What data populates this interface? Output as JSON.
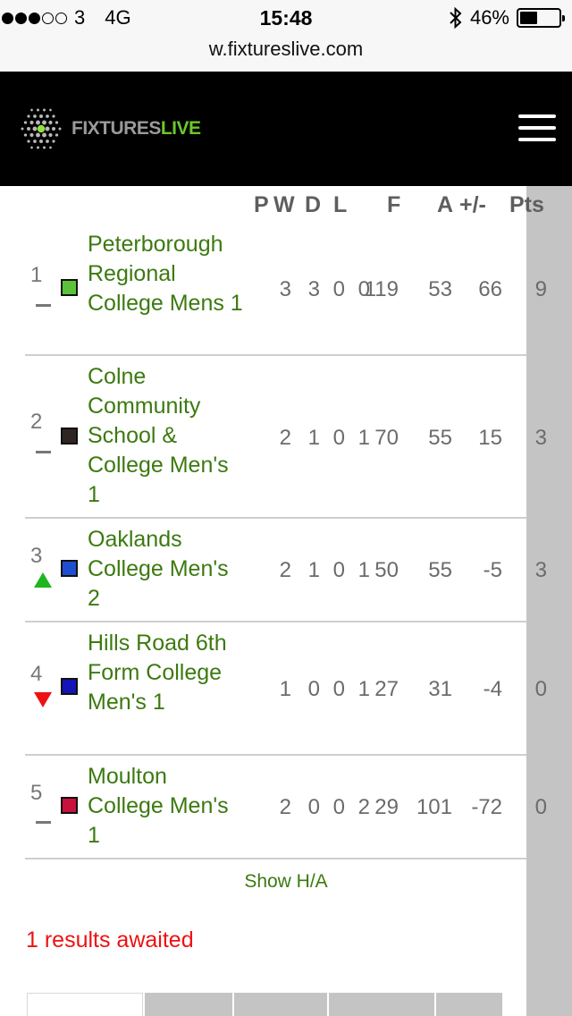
{
  "status_bar": {
    "signal_dots_filled": 3,
    "signal_dots_total": 5,
    "carrier": "3",
    "network": "4G",
    "time": "15:48",
    "battery_percent": "46%",
    "battery_level": 0.46
  },
  "browser": {
    "url": "w.fixtureslive.com"
  },
  "header": {
    "logo_text_grey": "FIXTURES",
    "logo_text_green": "LIVE",
    "menu_icon": "hamburger-menu-icon"
  },
  "table": {
    "columns": {
      "p": "P",
      "w": "W",
      "d": "D",
      "l": "L",
      "f": "F",
      "a": "A",
      "diff": "+/-",
      "pts": "Pts"
    },
    "rows": [
      {
        "pos": "1",
        "movement": "none",
        "color": "#5cc23a",
        "team": "Peterborough Regional College Mens 1",
        "p": "3",
        "w": "3",
        "d": "0",
        "l": "0",
        "f": "119",
        "a": "53",
        "diff": "66",
        "pts": "9"
      },
      {
        "pos": "2",
        "movement": "none",
        "color": "#2f2624",
        "team": "Colne Community School & College Men's 1",
        "p": "2",
        "w": "1",
        "d": "0",
        "l": "1",
        "f": "70",
        "a": "55",
        "diff": "15",
        "pts": "3"
      },
      {
        "pos": "3",
        "movement": "up",
        "color": "#1e4fd0",
        "team": "Oaklands College Men's 2",
        "p": "2",
        "w": "1",
        "d": "0",
        "l": "1",
        "f": "50",
        "a": "55",
        "diff": "-5",
        "pts": "3"
      },
      {
        "pos": "4",
        "movement": "down",
        "color": "#1414b8",
        "team": "Hills Road 6th Form College Men's 1",
        "p": "1",
        "w": "0",
        "d": "0",
        "l": "1",
        "f": "27",
        "a": "31",
        "diff": "-4",
        "pts": "0"
      },
      {
        "pos": "5",
        "movement": "none",
        "color": "#c8123c",
        "team": "Moulton College Men's 1",
        "p": "2",
        "w": "0",
        "d": "0",
        "l": "2",
        "f": "29",
        "a": "101",
        "diff": "-72",
        "pts": "0"
      }
    ]
  },
  "links": {
    "show_ha": "Show H/A"
  },
  "notices": {
    "results_awaited": "1 results awaited"
  },
  "colors": {
    "header_bg": "#000000",
    "team_green": "#3c7a10",
    "alert_red": "#ee1111",
    "logo_green": "#6cc72a"
  }
}
